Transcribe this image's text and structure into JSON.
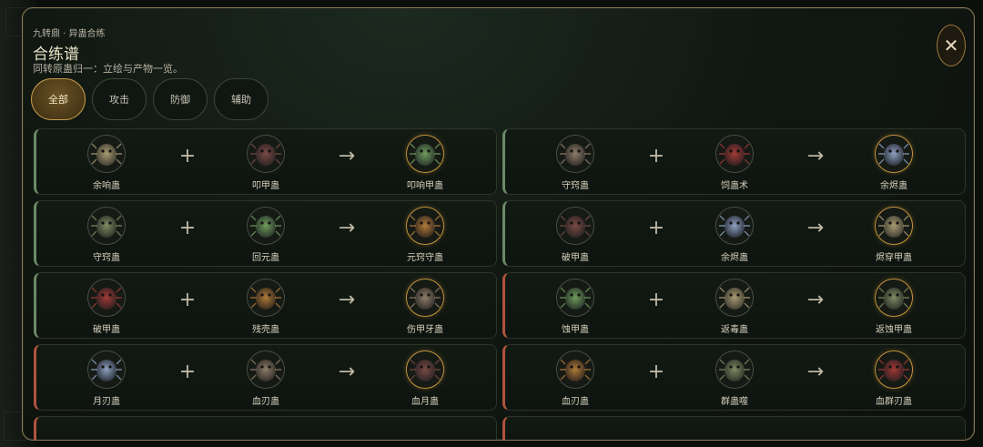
{
  "header": {
    "breadcrumb": "九转鼎 · 异蛊合练",
    "title": "合练谱",
    "subtitle": "同转原蛊归一：立绘与产物一览。"
  },
  "close_icon": "close-icon",
  "tabs": [
    {
      "label": "全部",
      "active": true
    },
    {
      "label": "攻击",
      "active": false
    },
    {
      "label": "防御",
      "active": false
    },
    {
      "label": "辅助",
      "active": false
    }
  ],
  "symbols": {
    "plus": "+",
    "arrow": "→"
  },
  "colors": {
    "accent_gold": "#c9963c",
    "green_border": "#6a8a66",
    "red_border": "#b0533e"
  },
  "recipes": [
    {
      "a": "余响蛊",
      "b": "叩甲蛊",
      "result": "叩响甲蛊",
      "tint": "green"
    },
    {
      "a": "守窍蛊",
      "b": "饲蛊术",
      "result": "余烬蛊",
      "tint": "green"
    },
    {
      "a": "守窍蛊",
      "b": "回元蛊",
      "result": "元窍守蛊",
      "tint": "green"
    },
    {
      "a": "破甲蛊",
      "b": "余烬蛊",
      "result": "烬穿甲蛊",
      "tint": "green"
    },
    {
      "a": "破甲蛊",
      "b": "残壳蛊",
      "result": "伤甲牙蛊",
      "tint": "green"
    },
    {
      "a": "蚀甲蛊",
      "b": "返毒蛊",
      "result": "返蚀甲蛊",
      "tint": "red"
    },
    {
      "a": "月刃蛊",
      "b": "血刃蛊",
      "result": "血月蛊",
      "tint": "red"
    },
    {
      "a": "血刃蛊",
      "b": "群蛊噬",
      "result": "血群刃蛊",
      "tint": "red"
    }
  ],
  "partial_rows": [
    {
      "tint": "red"
    },
    {
      "tint": "red"
    }
  ]
}
